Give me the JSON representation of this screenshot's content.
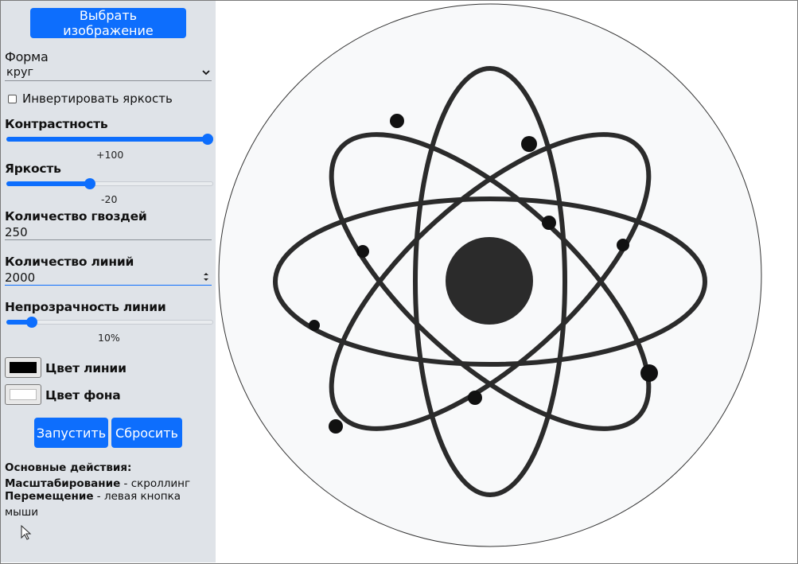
{
  "sidebar": {
    "choose_image_button": "Выбрать изображение",
    "shape_label": "Форма",
    "shape_value": "круг",
    "invert_label": "Инвертировать яркость",
    "contrast_label": "Контрастность",
    "contrast_value_text": "+100",
    "contrast_fraction": 1.0,
    "brightness_label": "Яркость",
    "brightness_value_text": "-20",
    "brightness_fraction": 0.4,
    "nails_label": "Количество гвоздей",
    "nails_value": "250",
    "lines_label": "Количество линий",
    "lines_value": "2000",
    "opacity_label": "Непрозрачность линии",
    "opacity_value_text": "10%",
    "opacity_fraction": 0.1,
    "line_color_label": "Цвет линии",
    "line_color": "#000000",
    "bg_color_label": "Цвет фона",
    "bg_color": "#ffffff",
    "start_button": "Запустить",
    "reset_button": "Сбросить",
    "help_title": "Основные действия:",
    "help_zoom_bold": "Масштабирование",
    "help_zoom_text": " - скроллинг",
    "help_move_bold": "Перемещение",
    "help_move_text": " - левая кнопка мыши"
  },
  "colors": {
    "accent": "#0d6efd",
    "sidebar_bg": "#dfe3e8",
    "art_stroke": "#2b2b2b"
  },
  "icons": {
    "cursor": "mouse-pointer-icon",
    "dropdown": "chevron-down-icon",
    "spinner": "spinner-arrows-icon"
  }
}
